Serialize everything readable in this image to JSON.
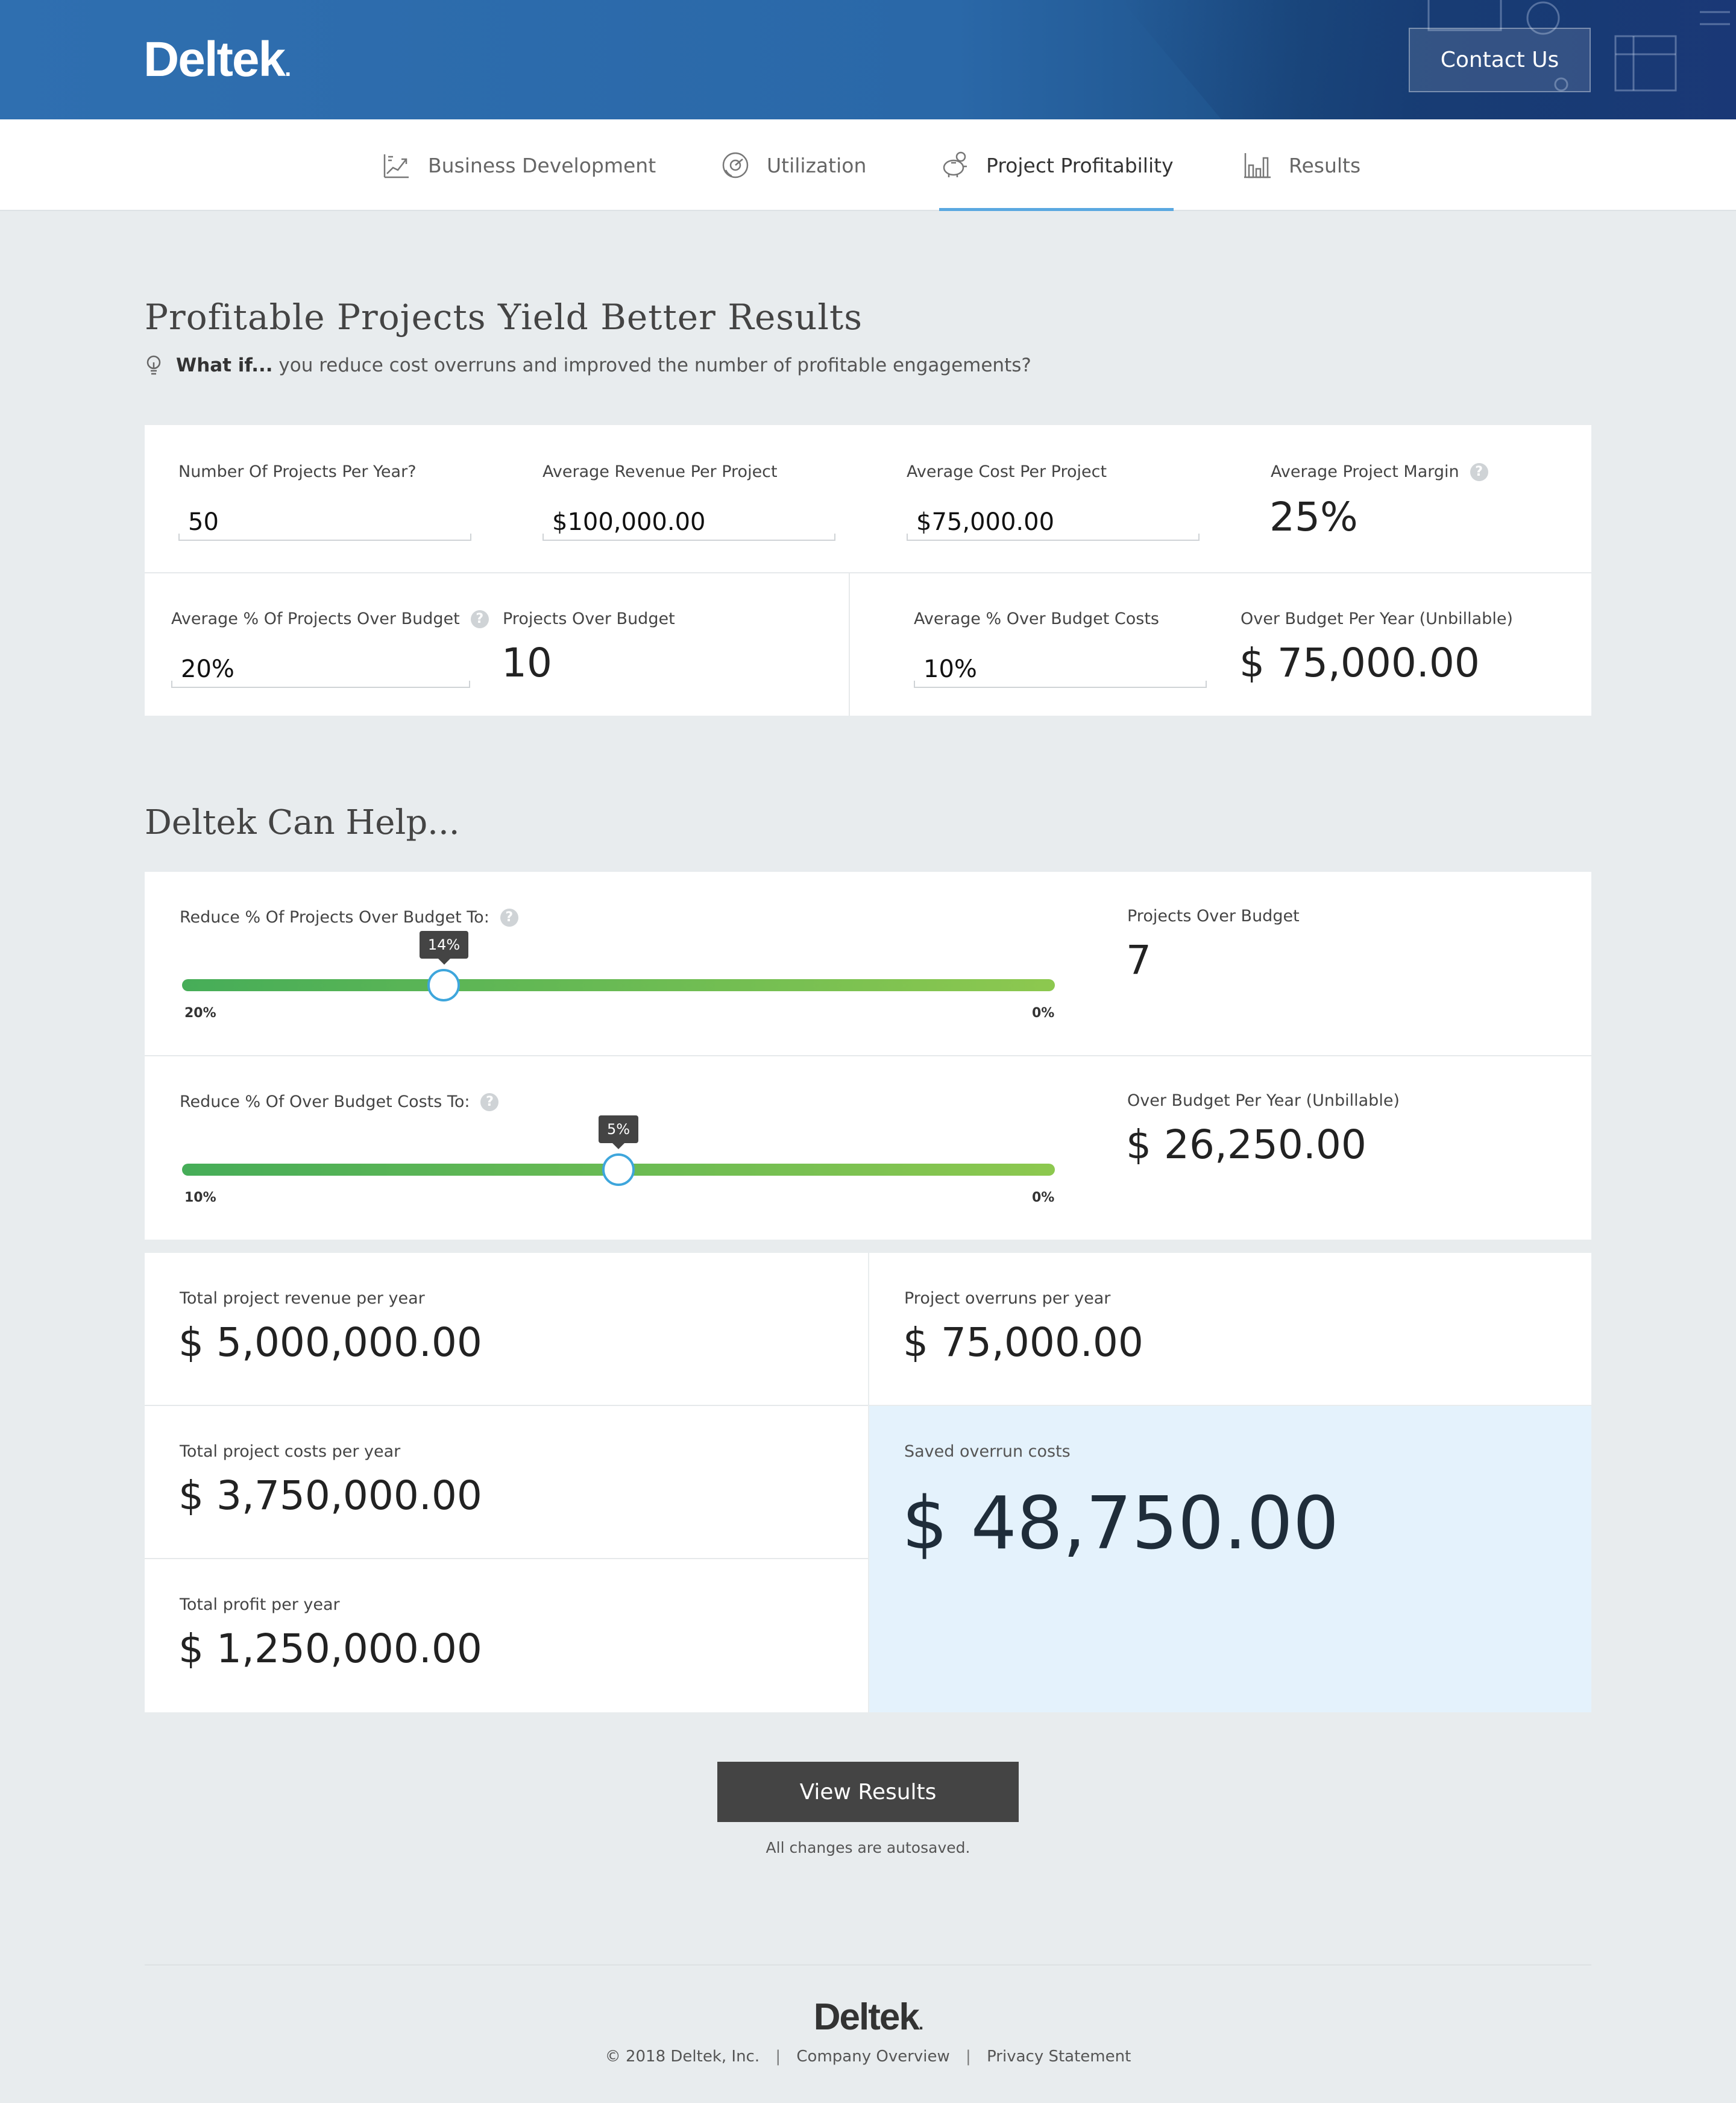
{
  "header": {
    "logo": "Deltek",
    "contact_label": "Contact Us"
  },
  "nav": {
    "items": [
      {
        "label": "Business Development",
        "icon": "chart-growth-icon"
      },
      {
        "label": "Utilization",
        "icon": "gauge-icon"
      },
      {
        "label": "Project Profitability",
        "icon": "piggy-bank-icon",
        "active": true
      },
      {
        "label": "Results",
        "icon": "bar-chart-icon"
      }
    ]
  },
  "intro": {
    "title": "Profitable Projects Yield Better Results",
    "whatif_bold": "What if...",
    "whatif_text": "you reduce cost overruns and improved the number of profitable engagements?"
  },
  "inputs": {
    "projects_per_year": {
      "label": "Number Of Projects Per Year?",
      "value": "50"
    },
    "avg_revenue": {
      "label": "Average Revenue Per Project",
      "value": "$100,000.00"
    },
    "avg_cost": {
      "label": "Average Cost Per Project",
      "value": "$75,000.00"
    },
    "avg_margin": {
      "label": "Average Project Margin",
      "value": "25%"
    },
    "pct_over_budget": {
      "label": "Average % Of Projects Over Budget",
      "value": "20%"
    },
    "projects_over_budget": {
      "label": "Projects Over Budget",
      "value": "10"
    },
    "pct_over_budget_costs": {
      "label": "Average % Over Budget Costs",
      "value": "10%"
    },
    "over_budget_per_year": {
      "label": "Over Budget Per Year (Unbillable)",
      "value": "$ 75,000.00"
    }
  },
  "help_section": {
    "title": "Deltek Can Help...",
    "slider1": {
      "label": "Reduce % Of Projects Over Budget To:",
      "value_label": "14%",
      "value": 14,
      "min_label": "20%",
      "max_label": "0%",
      "from": 20,
      "to": 0
    },
    "slider1_result": {
      "label": "Projects Over Budget",
      "value": "7"
    },
    "slider2": {
      "label": "Reduce % Of Over Budget Costs To:",
      "value_label": "5%",
      "value": 5,
      "min_label": "10%",
      "max_label": "0%",
      "from": 10,
      "to": 0
    },
    "slider2_result": {
      "label": "Over Budget Per Year (Unbillable)",
      "value": "$ 26,250.00"
    }
  },
  "summary": {
    "revenue": {
      "label": "Total project revenue per year",
      "value": "$ 5,000,000.00"
    },
    "overruns": {
      "label": "Project overruns per year",
      "value": "$ 75,000.00"
    },
    "costs": {
      "label": "Total project costs per year",
      "value": "$ 3,750,000.00"
    },
    "profit": {
      "label": "Total profit per year",
      "value": "$ 1,250,000.00"
    },
    "saved": {
      "label": "Saved overrun costs",
      "value": "$ 48,750.00"
    }
  },
  "actions": {
    "view_results": "View Results",
    "autosave": "All changes are autosaved."
  },
  "footer": {
    "logo": "Deltek",
    "copyright": "© 2018 Deltek, Inc.",
    "company_overview": "Company Overview",
    "privacy": "Privacy Statement"
  },
  "colors": {
    "header_blue": "#2f6fb0",
    "slider_green": "#46ad58",
    "knob_blue": "#3ea6dc",
    "saved_bg": "#e4f2fc",
    "nav_active": "#5aa8e0"
  }
}
